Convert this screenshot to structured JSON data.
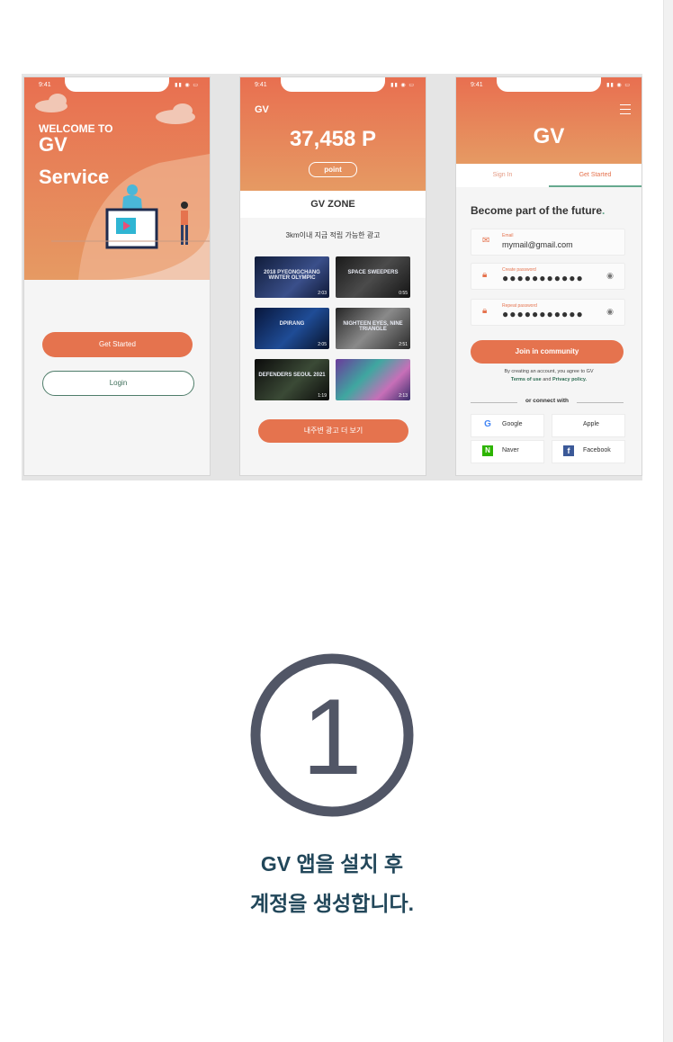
{
  "status": {
    "time": "9:41"
  },
  "phone1": {
    "welcome_line1": "WELCOME TO",
    "welcome_line2": "GV",
    "welcome_line3": "Service",
    "get_started": "Get Started",
    "login": "Login"
  },
  "phone2": {
    "brand": "GV",
    "points": "37,458 P",
    "point_label": "point",
    "zone_title": "GV ZONE",
    "zone_subtitle": "3km이내 지금 적립 가능한 광고",
    "thumbnails": [
      {
        "title": "2018 PYEONGCHANG WINTER OLYMPIC",
        "duration": "2:03"
      },
      {
        "title": "SPACE SWEEPERS",
        "duration": "0:55"
      },
      {
        "title": "DPIRANG",
        "duration": "2:05"
      },
      {
        "title": "NIGHTEEN EYES, NINE TRIANGLE",
        "duration": "2:51"
      },
      {
        "title": "DEFENDERS SEOUL 2021",
        "duration": "1:19"
      },
      {
        "title": "",
        "duration": "2:13"
      }
    ],
    "more_button": "내주변 광고 더 보기"
  },
  "phone3": {
    "brand": "GV",
    "tab_signin": "Sign In",
    "tab_getstarted": "Get Started",
    "headline": "Become part of the future",
    "email_label": "Email",
    "email_value": "mymail@gmail.com",
    "create_pw_label": "Create password",
    "repeat_pw_label": "Repeat password",
    "pw_mask": "●●●●●●●●●●●",
    "join_button": "Join in community",
    "agree_line1": "By creating an account, you agree to GV",
    "terms": "Terms of use",
    "and": "and",
    "privacy": "Privacy policy.",
    "or_connect": "or connect with",
    "social": {
      "google": "Google",
      "apple": "Apple",
      "naver": "Naver",
      "facebook": "Facebook"
    }
  },
  "step": {
    "number": "1",
    "caption_line1": "GV 앱을 설치 후",
    "caption_line2": "계정을 생성합니다."
  },
  "colors": {
    "accent": "#e5734e",
    "green": "#2f6d54",
    "caption": "#22475a",
    "circle": "#515666"
  }
}
